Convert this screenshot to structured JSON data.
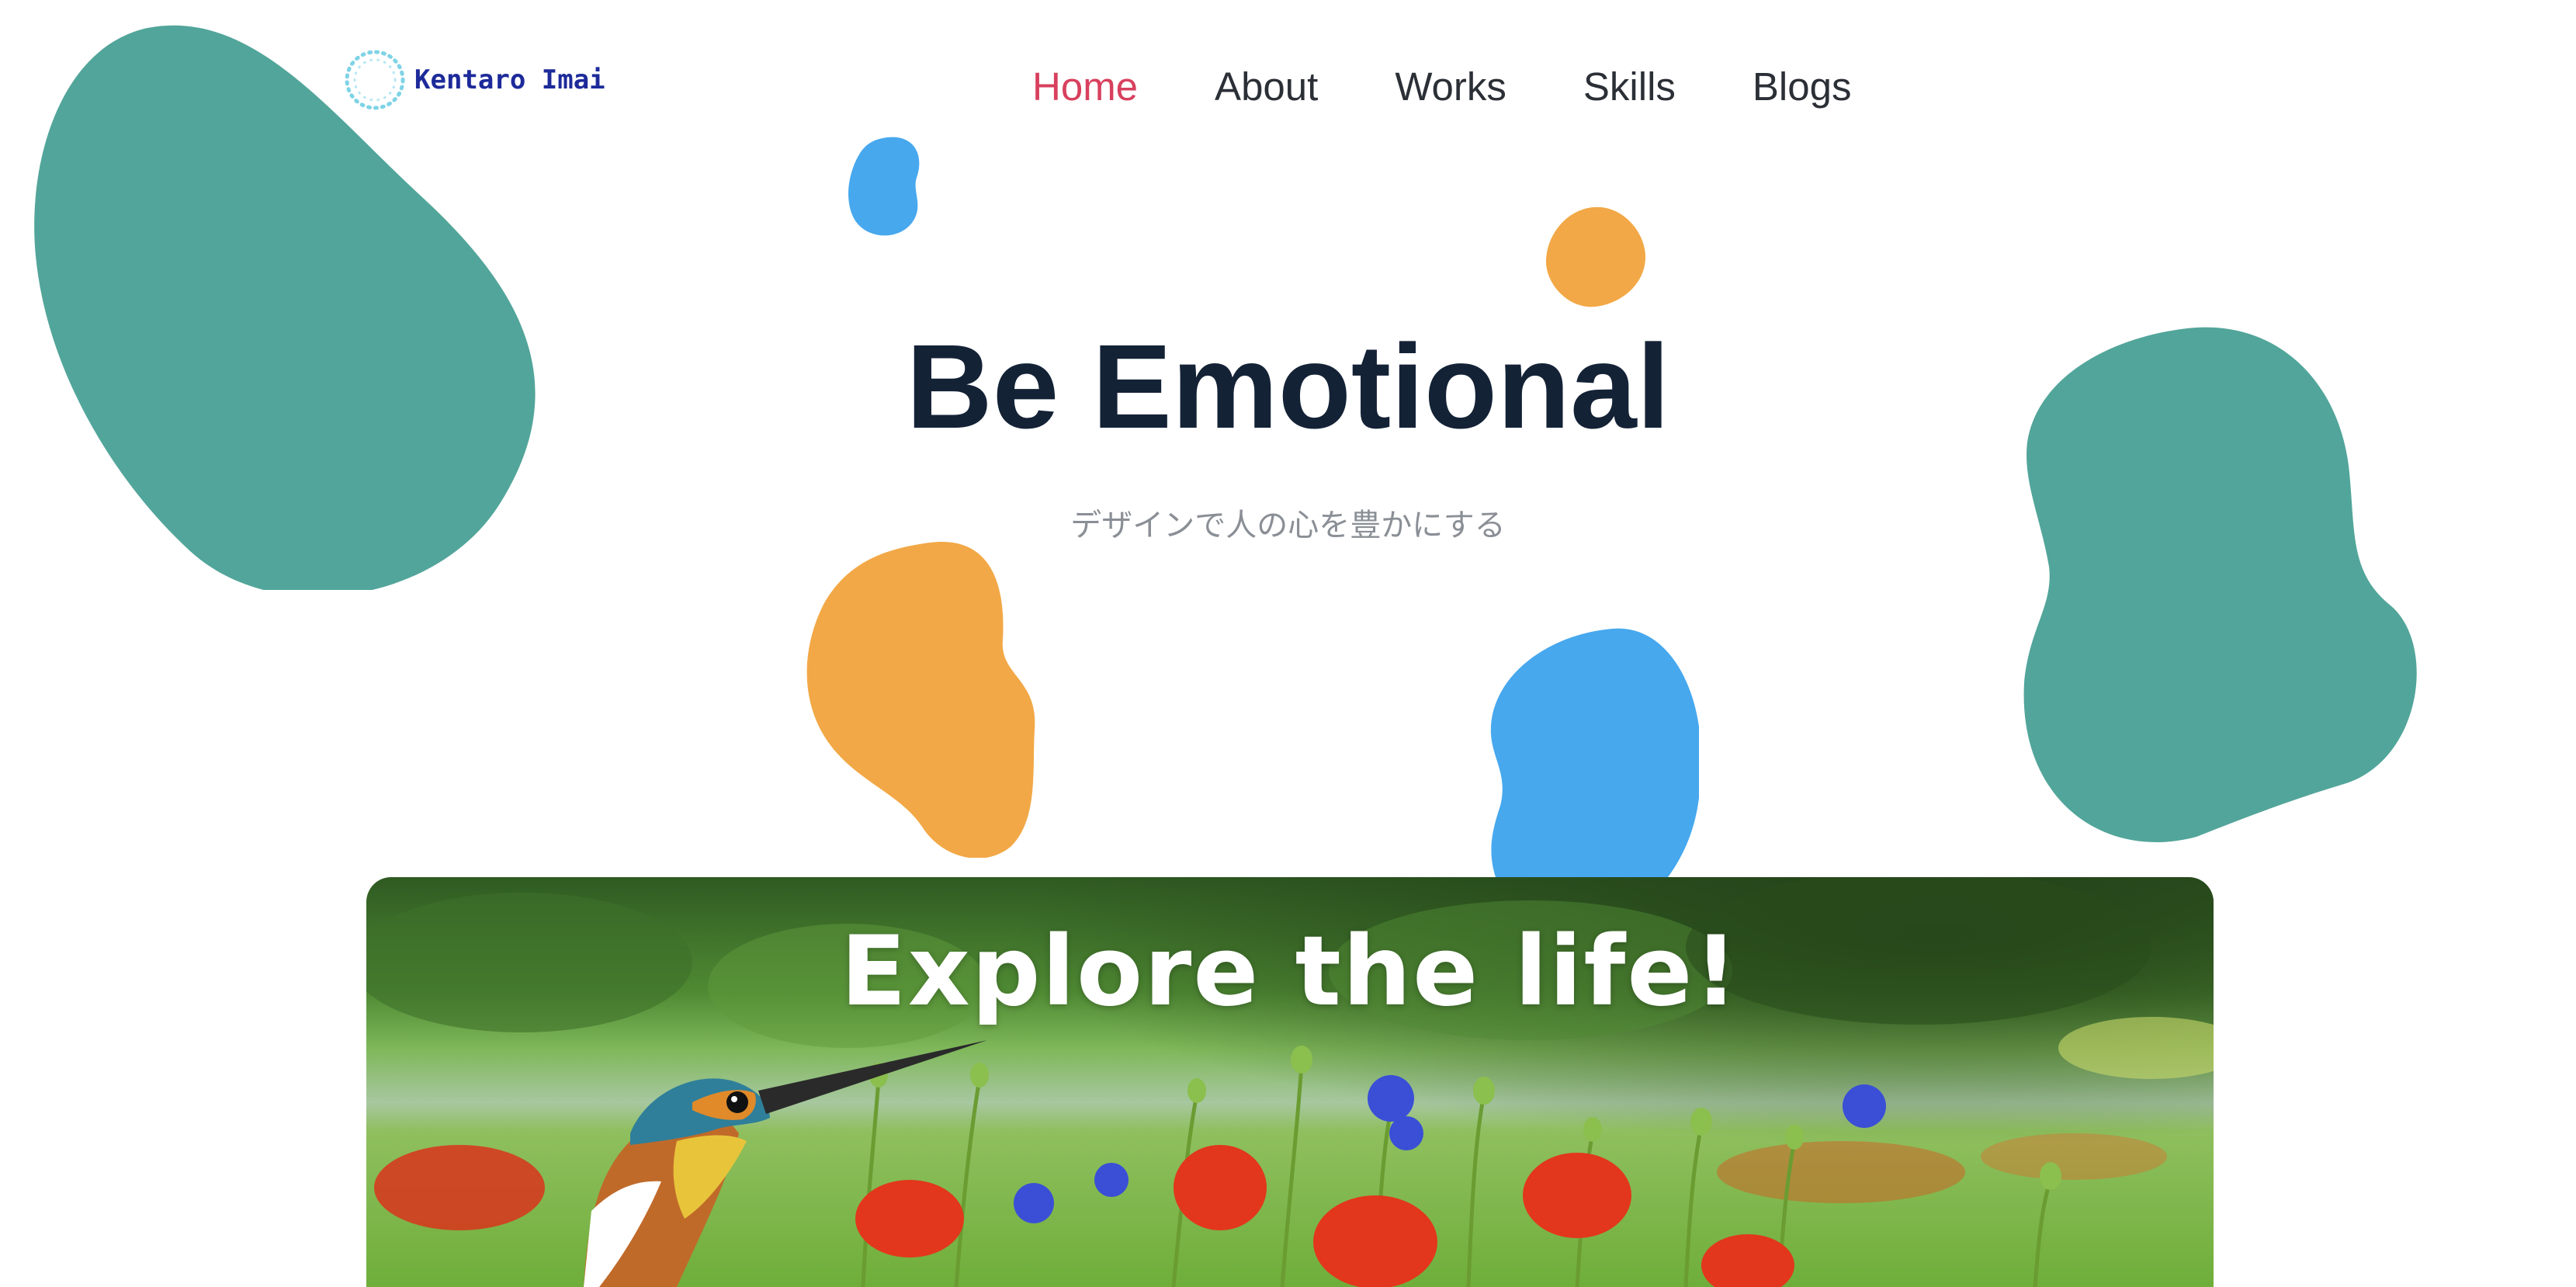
{
  "colors": {
    "teal": "#52a59a",
    "orange": "#f2a846",
    "blue": "#47a8ee",
    "nav_active": "#d8405e",
    "nav_text": "#2b2f36",
    "title": "#142236",
    "subtitle": "#8a8f96",
    "logo_text": "#1d2a9a",
    "logo_dots": "#7fd3e6"
  },
  "header": {
    "logo": {
      "icon": "dotted-circle-icon",
      "text": "Kentaro Imai"
    },
    "nav": [
      {
        "label": "Home",
        "active": true
      },
      {
        "label": "About",
        "active": false
      },
      {
        "label": "Works",
        "active": false
      },
      {
        "label": "Skills",
        "active": false
      },
      {
        "label": "Blogs",
        "active": false
      }
    ]
  },
  "hero": {
    "title": "Be Emotional",
    "subtitle": "デザインで人の心を豊かにする"
  },
  "banner": {
    "title": "Explore the life!",
    "image": "kingfisher-in-flower-field-photo"
  }
}
